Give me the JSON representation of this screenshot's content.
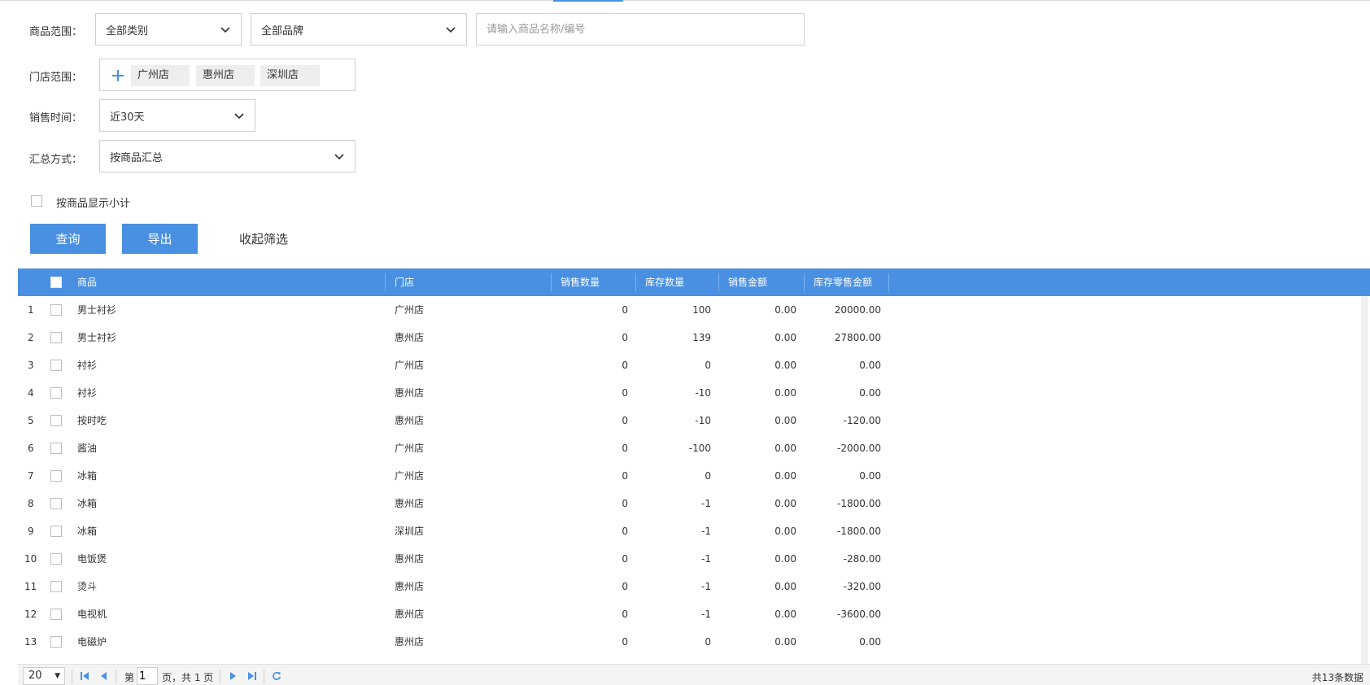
{
  "filters": {
    "product_scope_label": "商品范围：",
    "category_value": "全部类别",
    "brand_value": "全部品牌",
    "search_placeholder": "请输入商品名称/编号",
    "store_scope_label": "门店范围：",
    "stores": [
      "广州店",
      "惠州店",
      "深圳店"
    ],
    "sale_time_label": "销售时间：",
    "sale_time_value": "近30天",
    "summary_label": "汇总方式：",
    "summary_value": "按商品汇总",
    "subtotal_label": "按商品显示小计"
  },
  "actions": {
    "query": "查询",
    "export": "导出",
    "collapse": "收起筛选"
  },
  "table": {
    "columns": [
      "商品",
      "门店",
      "销售数量",
      "库存数量",
      "销售金额",
      "库存零售金额"
    ],
    "rows": [
      {
        "no": "1",
        "product": "男士衬衫",
        "store": "广州店",
        "sales_qty": "0",
        "stock_qty": "100",
        "sales_amt": "0.00",
        "stock_amt": "20000.00"
      },
      {
        "no": "2",
        "product": "男士衬衫",
        "store": "惠州店",
        "sales_qty": "0",
        "stock_qty": "139",
        "sales_amt": "0.00",
        "stock_amt": "27800.00"
      },
      {
        "no": "3",
        "product": "衬衫",
        "store": "广州店",
        "sales_qty": "0",
        "stock_qty": "0",
        "sales_amt": "0.00",
        "stock_amt": "0.00"
      },
      {
        "no": "4",
        "product": "衬衫",
        "store": "惠州店",
        "sales_qty": "0",
        "stock_qty": "-10",
        "sales_amt": "0.00",
        "stock_amt": "0.00"
      },
      {
        "no": "5",
        "product": "按时吃",
        "store": "惠州店",
        "sales_qty": "0",
        "stock_qty": "-10",
        "sales_amt": "0.00",
        "stock_amt": "-120.00"
      },
      {
        "no": "6",
        "product": "酱油",
        "store": "广州店",
        "sales_qty": "0",
        "stock_qty": "-100",
        "sales_amt": "0.00",
        "stock_amt": "-2000.00"
      },
      {
        "no": "7",
        "product": "冰箱",
        "store": "广州店",
        "sales_qty": "0",
        "stock_qty": "0",
        "sales_amt": "0.00",
        "stock_amt": "0.00"
      },
      {
        "no": "8",
        "product": "冰箱",
        "store": "惠州店",
        "sales_qty": "0",
        "stock_qty": "-1",
        "sales_amt": "0.00",
        "stock_amt": "-1800.00"
      },
      {
        "no": "9",
        "product": "冰箱",
        "store": "深圳店",
        "sales_qty": "0",
        "stock_qty": "-1",
        "sales_amt": "0.00",
        "stock_amt": "-1800.00"
      },
      {
        "no": "10",
        "product": "电饭煲",
        "store": "惠州店",
        "sales_qty": "0",
        "stock_qty": "-1",
        "sales_amt": "0.00",
        "stock_amt": "-280.00"
      },
      {
        "no": "11",
        "product": "烫斗",
        "store": "惠州店",
        "sales_qty": "0",
        "stock_qty": "-1",
        "sales_amt": "0.00",
        "stock_amt": "-320.00"
      },
      {
        "no": "12",
        "product": "电视机",
        "store": "惠州店",
        "sales_qty": "0",
        "stock_qty": "-1",
        "sales_amt": "0.00",
        "stock_amt": "-3600.00"
      },
      {
        "no": "13",
        "product": "电磁炉",
        "store": "惠州店",
        "sales_qty": "0",
        "stock_qty": "0",
        "sales_amt": "0.00",
        "stock_amt": "0.00"
      }
    ]
  },
  "pager": {
    "page_size": "20",
    "page_prefix": "第",
    "current_page": "1",
    "page_suffix": "页，共 1 页",
    "total": "共13条数据"
  },
  "colors": {
    "accent": "#4a90e2"
  }
}
